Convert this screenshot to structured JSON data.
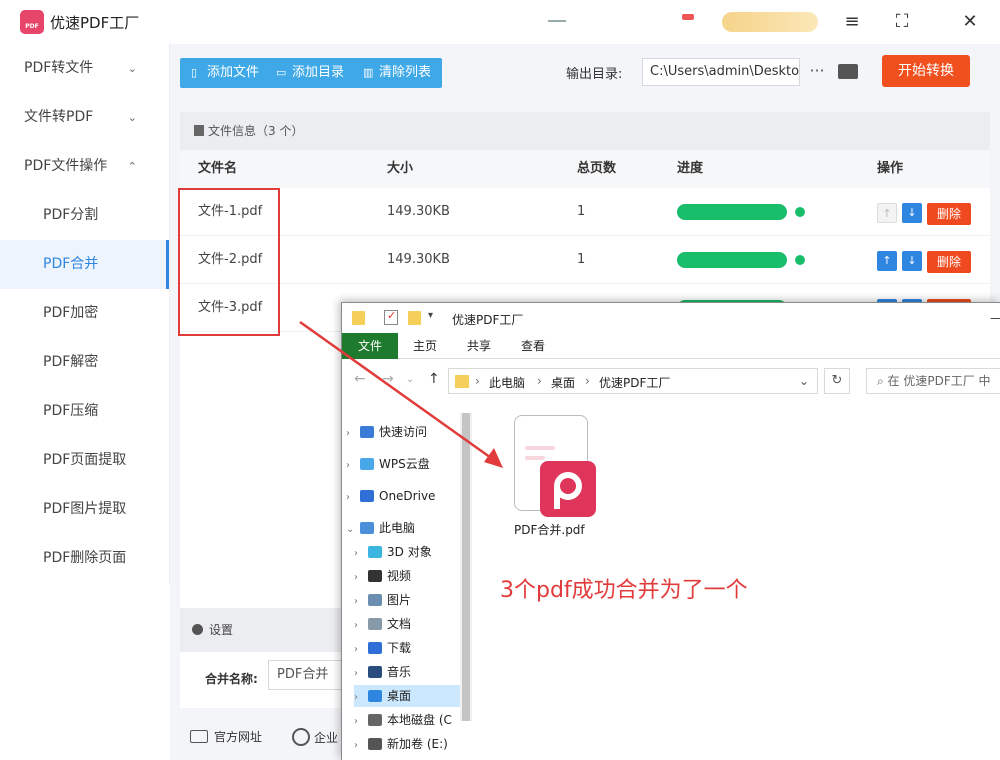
{
  "app": {
    "title": "优速PDF工厂"
  },
  "sidebar": {
    "items": [
      {
        "label": "PDF转文件",
        "kind": "group",
        "chevron": "⌄"
      },
      {
        "label": "文件转PDF",
        "kind": "group",
        "chevron": "⌄"
      },
      {
        "label": "PDF文件操作",
        "kind": "group",
        "chevron": "⌃"
      },
      {
        "label": "PDF分割",
        "kind": "sub"
      },
      {
        "label": "PDF合并",
        "kind": "sub",
        "active": true
      },
      {
        "label": "PDF加密",
        "kind": "sub"
      },
      {
        "label": "PDF解密",
        "kind": "sub"
      },
      {
        "label": "PDF压缩",
        "kind": "sub"
      },
      {
        "label": "PDF页面提取",
        "kind": "sub"
      },
      {
        "label": "PDF图片提取",
        "kind": "sub"
      },
      {
        "label": "PDF删除页面",
        "kind": "sub"
      }
    ]
  },
  "toolbar": {
    "add_file": "添加文件",
    "add_dir": "添加目录",
    "clear_list": "清除列表",
    "output_label": "输出目录:",
    "output_path": "C:\\Users\\admin\\Deskto",
    "more": "···",
    "start": "开始转换"
  },
  "files": {
    "header": "文件信息（3 个）",
    "columns": [
      "文件名",
      "大小",
      "总页数",
      "进度",
      "操作"
    ],
    "rows": [
      {
        "name": "文件-1.pdf",
        "size": "149.30KB",
        "pages": "1",
        "progress": 1.0
      },
      {
        "name": "文件-2.pdf",
        "size": "149.30KB",
        "pages": "1",
        "progress": 1.0
      },
      {
        "name": "文件-3.pdf",
        "size": "",
        "pages": "",
        "progress": 1.0
      }
    ],
    "delete_label": "删除"
  },
  "settings": {
    "header": "设置",
    "merge_label": "合并名称:",
    "merge_value": "PDF合并"
  },
  "footer": {
    "website": "官方网址",
    "enterprise": "企业"
  },
  "explorer": {
    "title": "优速PDF工厂",
    "ribbon": [
      "文件",
      "主页",
      "共享",
      "查看"
    ],
    "address": [
      "此电脑",
      "桌面",
      "优速PDF工厂"
    ],
    "search_placeholder": "在 优速PDF工厂 中",
    "nav": [
      {
        "label": "快速访问",
        "level": 0
      },
      {
        "label": "WPS云盘",
        "level": 0
      },
      {
        "label": "OneDrive",
        "level": 0
      },
      {
        "label": "此电脑",
        "level": 0,
        "expanded": true
      },
      {
        "label": "3D 对象",
        "level": 1
      },
      {
        "label": "视频",
        "level": 1
      },
      {
        "label": "图片",
        "level": 1
      },
      {
        "label": "文档",
        "level": 1
      },
      {
        "label": "下载",
        "level": 1
      },
      {
        "label": "音乐",
        "level": 1
      },
      {
        "label": "桌面",
        "level": 1,
        "selected": true
      },
      {
        "label": "本地磁盘 (C",
        "level": 1
      },
      {
        "label": "新加卷 (E:)",
        "level": 1
      }
    ],
    "file_name": "PDF合并.pdf"
  },
  "annotation": {
    "text": "3个pdf成功合并为了一个"
  },
  "colors": {
    "accent": "#2f86e0",
    "start": "#f0501e",
    "progress": "#19be6b",
    "annotation": "#e23b3b"
  }
}
